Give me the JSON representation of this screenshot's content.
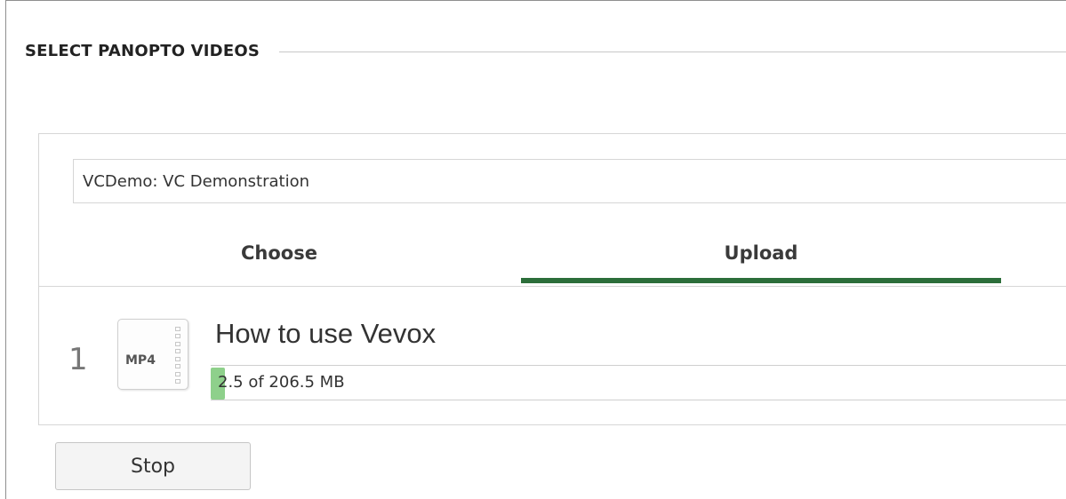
{
  "section": {
    "title": "SELECT PANOPTO VIDEOS"
  },
  "folder": {
    "value": "VCDemo: VC Demonstration"
  },
  "tabs": [
    {
      "label": "Choose",
      "active": false
    },
    {
      "label": "Upload",
      "active": true
    }
  ],
  "uploads": [
    {
      "index": "1",
      "file_type": "MP4",
      "title": "How to use Vevox",
      "progress_text": "2.5 of 206.5 MB",
      "progress_fraction": 0.0121
    }
  ],
  "actions": {
    "stop_label": "Stop"
  },
  "colors": {
    "accent": "#2c6e3a",
    "progress": "#8ed08b"
  }
}
